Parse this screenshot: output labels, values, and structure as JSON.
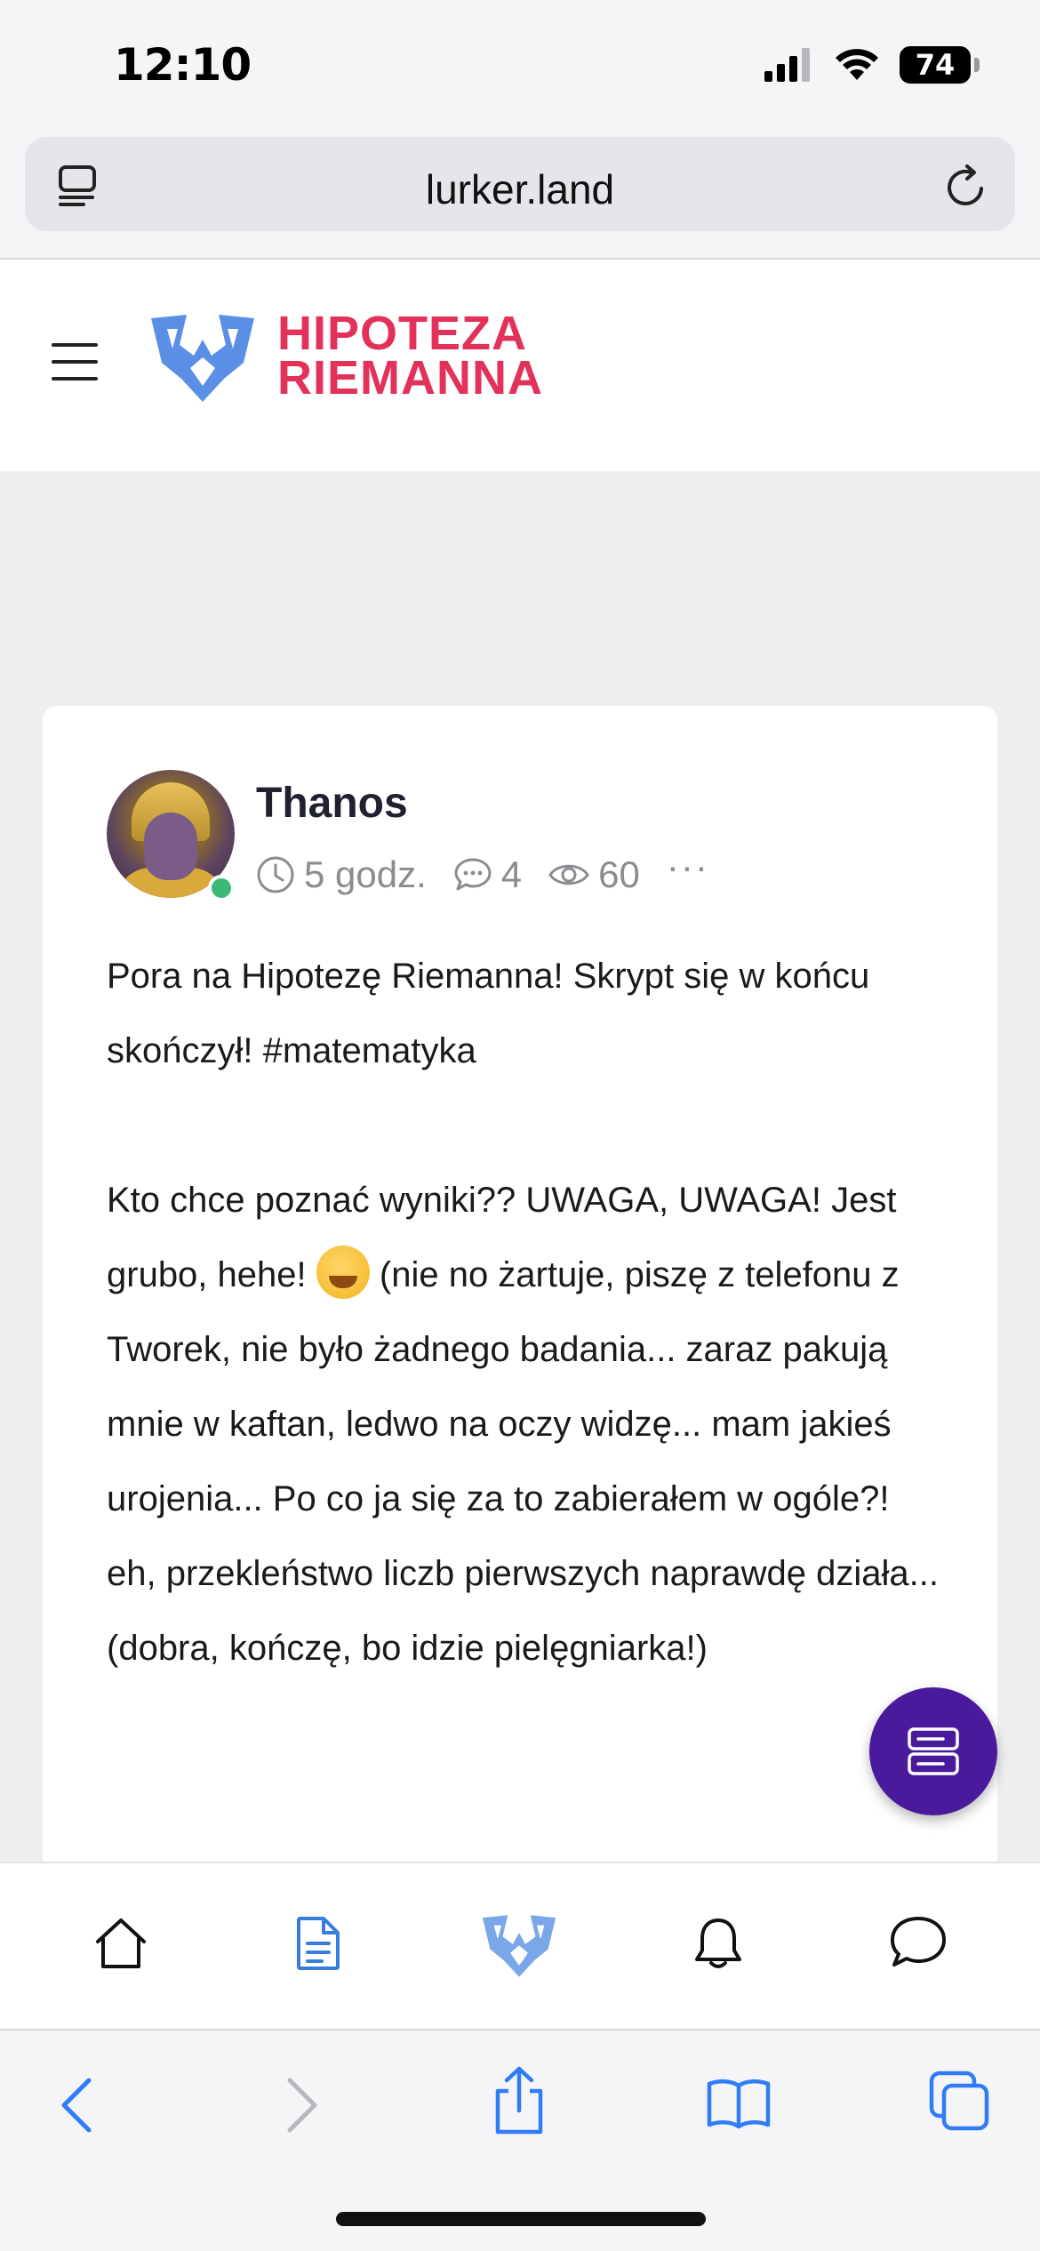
{
  "status_bar": {
    "time": "12:10",
    "battery": "74",
    "icons": [
      "cellular-signal-icon",
      "wifi-icon",
      "battery-icon"
    ]
  },
  "browser": {
    "url": "lurker.land"
  },
  "site": {
    "logo_line1": "HIPOTEZA",
    "logo_line2": "RIEMANNA",
    "brand_color": "#e2325a",
    "accent_color": "#5b8fe6"
  },
  "post": {
    "author": "Thanos",
    "time": "5 godz.",
    "comments": "4",
    "views": "60",
    "more": "···",
    "paragraph1": "Pora na Hipotezę Riemanna! Skrypt się w końcu skończył! #matematyka",
    "paragraph2_before_emoji": "Kto chce poznać wyniki?? UWAGA, UWAGA! Jest grubo, hehe!",
    "paragraph2_after_emoji": "(nie no żartuje, piszę z telefonu z Tworek, nie było żadnego badania... zaraz pakują mnie w kaftan, ledwo na oczy widzę... mam jakieś urojenia... Po co ja się za to zabierałem w ogóle?! eh, przekleństwo liczb pierwszych naprawdę działa... (dobra, kończę, bo idzie pielęgniarka!)"
  },
  "fab_color": "#4a1a9c",
  "app_nav": [
    "home-icon",
    "document-icon",
    "logo-icon",
    "bell-icon",
    "chat-icon"
  ],
  "safari_toolbar": [
    "back-icon",
    "forward-icon",
    "share-icon",
    "bookmarks-icon",
    "tabs-icon"
  ]
}
